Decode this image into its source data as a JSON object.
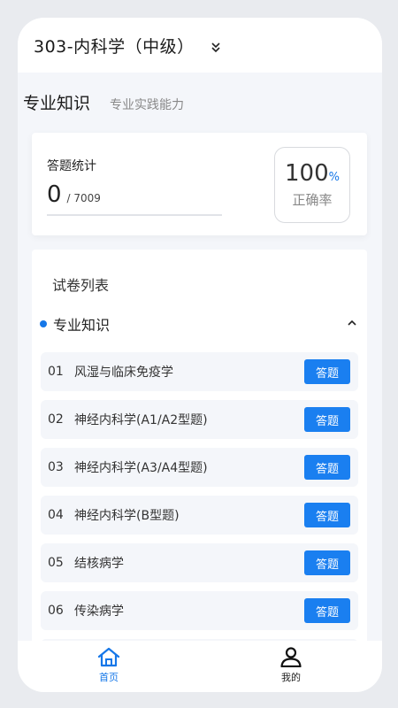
{
  "header": {
    "title": "303-内科学（中级）"
  },
  "tabs": {
    "active": "专业知识",
    "other": "专业实践能力"
  },
  "stats": {
    "label": "答题统计",
    "answered": "0",
    "total": "/ 7009",
    "rate_value": "100",
    "rate_unit": "%",
    "rate_label": "正确率"
  },
  "list": {
    "title": "试卷列表",
    "section": "专业知识",
    "button_label": "答题",
    "items": [
      {
        "num": "01",
        "name": "风湿与临床免疫学"
      },
      {
        "num": "02",
        "name": "神经内科学(A1/A2型题)"
      },
      {
        "num": "03",
        "name": "神经内科学(A3/A4型题)"
      },
      {
        "num": "04",
        "name": "神经内科学(B型题)"
      },
      {
        "num": "05",
        "name": "结核病学"
      },
      {
        "num": "06",
        "name": "传染病学"
      }
    ]
  },
  "nav": {
    "home": "首页",
    "mine": "我的"
  },
  "colors": {
    "accent": "#1677e8",
    "button": "#1a7ff0"
  },
  "icons": {
    "header": "chevron-double-down-icon",
    "section": "chevron-up-icon",
    "home": "home-icon",
    "mine": "user-icon"
  }
}
